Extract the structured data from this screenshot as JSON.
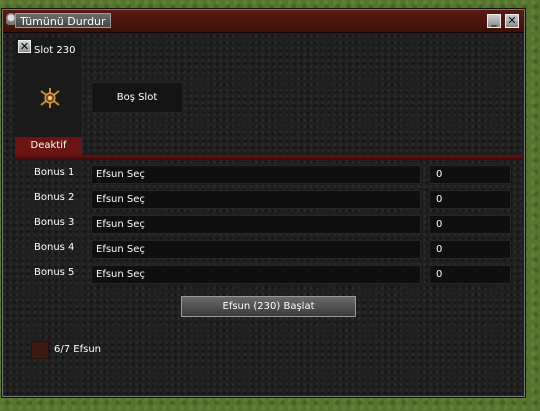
{
  "window": {
    "title": "Tümünü Durdur",
    "minimize_label": "_",
    "close_label": "✕"
  },
  "slot": {
    "title": "Slot 230",
    "close_label": "✕",
    "icon": "item-icon",
    "status": "Deaktif",
    "empty_label": "Boş Slot"
  },
  "bonuses": [
    {
      "label": "Bonus 1",
      "efsun": "Efsun Seç",
      "value": "0"
    },
    {
      "label": "Bonus 2",
      "efsun": "Efsun Seç",
      "value": "0"
    },
    {
      "label": "Bonus 3",
      "efsun": "Efsun Seç",
      "value": "0"
    },
    {
      "label": "Bonus 4",
      "efsun": "Efsun Seç",
      "value": "0"
    },
    {
      "label": "Bonus 5",
      "efsun": "Efsun Seç",
      "value": "0"
    }
  ],
  "start_button": {
    "label": "Efsun (230) Başlat"
  },
  "efsun_count": {
    "label": "6/7 Efsun"
  },
  "colors": {
    "accent_red": "#6a1414",
    "panel_bg": "#1f1f1f",
    "text": "#ffffff"
  }
}
